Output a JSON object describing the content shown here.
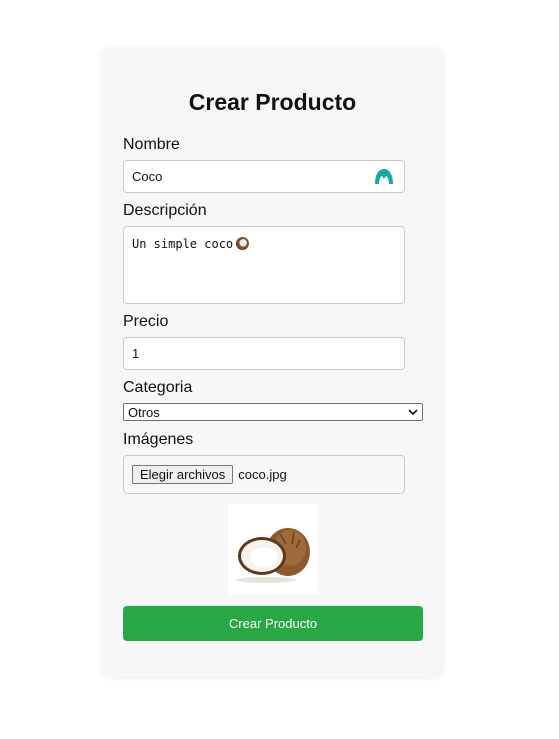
{
  "form": {
    "title": "Crear Producto",
    "nombre": {
      "label": "Nombre",
      "value": "Coco"
    },
    "descripcion": {
      "label": "Descripción",
      "value": "Un simple coco"
    },
    "precio": {
      "label": "Precio",
      "value": "1"
    },
    "categoria": {
      "label": "Categoria",
      "selected": "Otros"
    },
    "imagenes": {
      "label": "Imágenes",
      "button_label": "Elegir archivos",
      "file_name": "coco.jpg"
    },
    "submit_label": "Crear Producto"
  },
  "icons": {
    "extension_icon": "autofill-extension-icon",
    "emoji": "coconut-emoji",
    "dropdown": "chevron-down-icon"
  },
  "colors": {
    "submit": "#28a745",
    "card_background": "#f7f7f7",
    "extension_icon": "#1aa7a7"
  }
}
